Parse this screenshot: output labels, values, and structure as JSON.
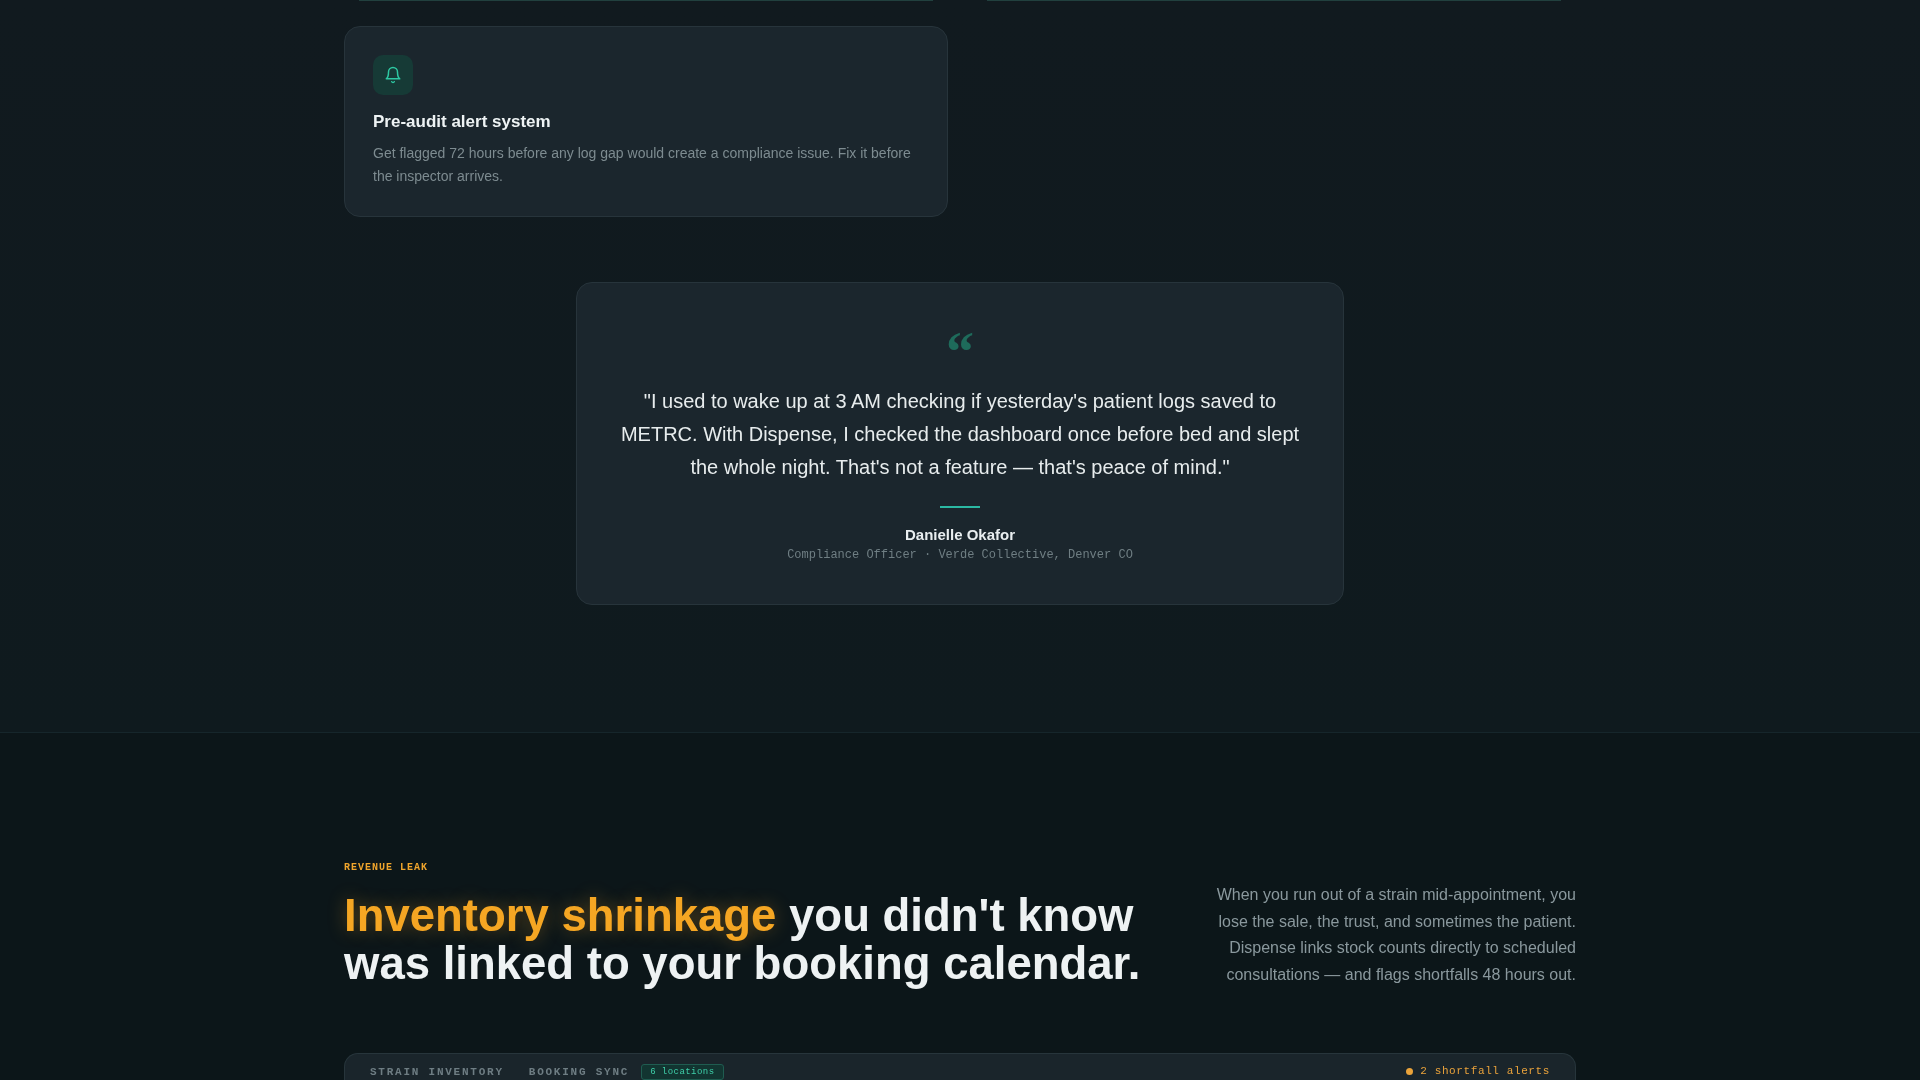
{
  "feature_card": {
    "title": "Pre-audit alert system",
    "description": "Get flagged 72 hours before any log gap would create a compliance issue. Fix it before the inspector arrives."
  },
  "testimonial": {
    "quote_mark": "“",
    "quote": "\"I used to wake up at 3 AM checking if yesterday's patient logs saved to METRC. With Dispense, I checked the dashboard once before bed and slept the whole night. That's not a feature — that's peace of mind.\"",
    "name": "Danielle Okafor",
    "role": "Compliance Officer · Verde Collective, Denver CO"
  },
  "revenue_section": {
    "eyebrow": "REVENUE LEAK",
    "heading": {
      "highlight": "Inventory shrinkage",
      "rest": " you didn't know was linked to your booking calendar."
    },
    "description": "When you run out of a strain mid-appointment, you lose the sale, the trust, and sometimes the patient. Dispense links stock counts directly to scheduled consultations — and flags shortfalls 48 hours out.",
    "panel": {
      "labels": [
        "STRAIN INVENTORY",
        "BOOKING SYNC"
      ],
      "badge": "6 locations",
      "alert": "2 shortfall alerts"
    }
  }
}
